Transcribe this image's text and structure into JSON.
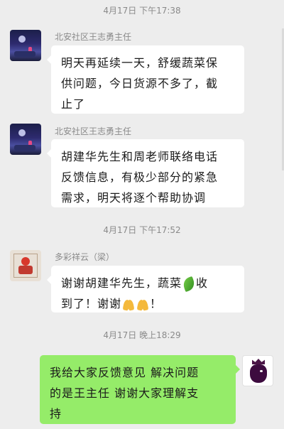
{
  "chat": {
    "timestamps": [
      "4月17日 下午17:38",
      "4月17日 下午17:52",
      "4月17日 晚上18:29"
    ],
    "messages": [
      {
        "sender": "北安社区王志勇主任",
        "avatar_icon": "night-scene-avatar",
        "lines": [
          "明天再延续一天，舒缓蔬菜保",
          "供问题，今日货源不多了，截",
          "止了"
        ]
      },
      {
        "sender": "北安社区王志勇主任",
        "avatar_icon": "night-scene-avatar",
        "lines": [
          "胡建华先生和周老师联络电话",
          "反馈信息，有极少部分的紧急",
          "需求，明天将逐个帮助协调"
        ]
      },
      {
        "sender": "多彩祥云（梁）",
        "avatar_icon": "red-figure-avatar",
        "line1_before": "谢谢胡建华先生，蔬菜",
        "line1_emoji": "leafy-green-emoji",
        "line1_after": "收",
        "line2_before": "到了！谢谢",
        "line2_emoji": "folded-hands-emoji",
        "line2_after": "！"
      },
      {
        "sender": "",
        "avatar_icon": "lion-crest-avatar",
        "lines": [
          "我给大家反馈意见 解决问题",
          "的是王主任 谢谢大家理解支",
          "持"
        ]
      }
    ]
  },
  "colors": {
    "background": "#ededed",
    "bubble_incoming": "#ffffff",
    "bubble_outgoing": "#95ec69",
    "meta_text": "#8a8a8a"
  }
}
